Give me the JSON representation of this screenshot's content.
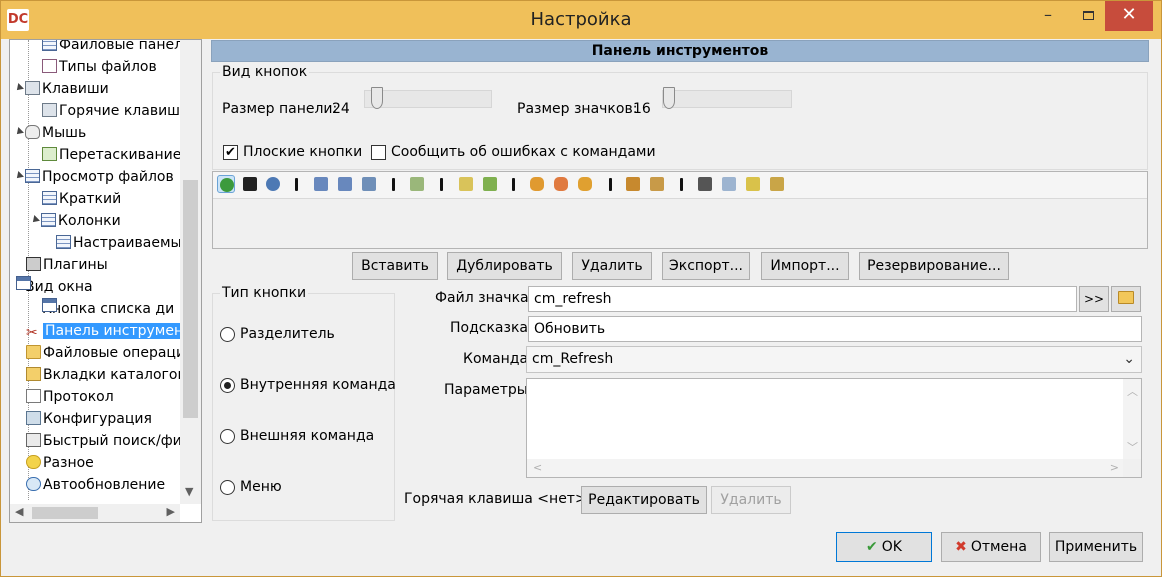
{
  "window": {
    "title": "Настройка",
    "app_icon": "DC",
    "minimize": "–",
    "close": "✕"
  },
  "tree": {
    "items": [
      {
        "label": "Файловые панел",
        "icon": "grid-icon"
      },
      {
        "label": "Типы файлов",
        "icon": "doc-icon"
      },
      {
        "label": "Клавиши",
        "icon": "keyboard-icon"
      },
      {
        "label": "Горячие клавиш",
        "icon": "keyboard-icon"
      },
      {
        "label": "Мышь",
        "icon": "mouse-icon"
      },
      {
        "label": "Перетаскивание",
        "icon": "drag-icon"
      },
      {
        "label": "Просмотр файлов",
        "icon": "grid-icon"
      },
      {
        "label": "Краткий",
        "icon": "grid-icon"
      },
      {
        "label": "Колонки",
        "icon": "grid-icon"
      },
      {
        "label": "Настраиваемы",
        "icon": "grid-icon"
      },
      {
        "label": "Плагины",
        "icon": "plugin-icon"
      },
      {
        "label": "Вид окна",
        "icon": "window-icon"
      },
      {
        "label": "Кнопка списка ди",
        "icon": "window-icon"
      },
      {
        "label": "Панель инструмент",
        "icon": "tools-icon"
      },
      {
        "label": "Файловые операци",
        "icon": "folder-icon"
      },
      {
        "label": "Вкладки каталогов",
        "icon": "tabs-icon"
      },
      {
        "label": "Протокол",
        "icon": "log-icon"
      },
      {
        "label": "Конфигурация",
        "icon": "config-icon"
      },
      {
        "label": "Быстрый поиск/фи",
        "icon": "search-icon"
      },
      {
        "label": "Разное",
        "icon": "misc-icon"
      },
      {
        "label": "Автообновление",
        "icon": "update-icon"
      }
    ]
  },
  "panel": {
    "header": "Панель инструментов",
    "view_group": {
      "title": "Вид кнопок",
      "panel_size_label": "Размер панели:",
      "panel_size_value": "24",
      "icon_size_label": "Размер значков:",
      "icon_size_value": "16",
      "flat_buttons_label": "Плоские кнопки",
      "flat_buttons_checked": true,
      "report_errors_label": "Сообщить об ошибках с командами",
      "report_errors_checked": false
    },
    "actions": {
      "insert": "Вставить",
      "duplicate": "Дублировать",
      "delete": "Удалить",
      "export": "Экспорт...",
      "import": "Импорт...",
      "backup": "Резервирование..."
    },
    "button_type": {
      "title": "Тип кнопки",
      "options": [
        "Разделитель",
        "Внутренняя команда",
        "Внешняя команда",
        "Меню"
      ],
      "selected": 1
    },
    "fields": {
      "icon_file_label": "Файл значка:",
      "icon_file_value": "cm_refresh",
      "browse_label": ">>",
      "hint_label": "Подсказка:",
      "hint_value": "Обновить",
      "command_label": "Команда",
      "command_value": "cm_Refresh",
      "params_label": "Параметры",
      "params_value": ""
    },
    "hotkey": {
      "label": "Горячая клавиша <нет>",
      "edit": "Редактировать",
      "delete": "Удалить"
    }
  },
  "footer": {
    "ok": "OK",
    "cancel": "Отмена",
    "apply": "Применить"
  },
  "colors": {
    "titlebar": "#f0c05a",
    "header": "#99b4d1",
    "selection": "#3399ff",
    "close": "#c74c3c"
  }
}
